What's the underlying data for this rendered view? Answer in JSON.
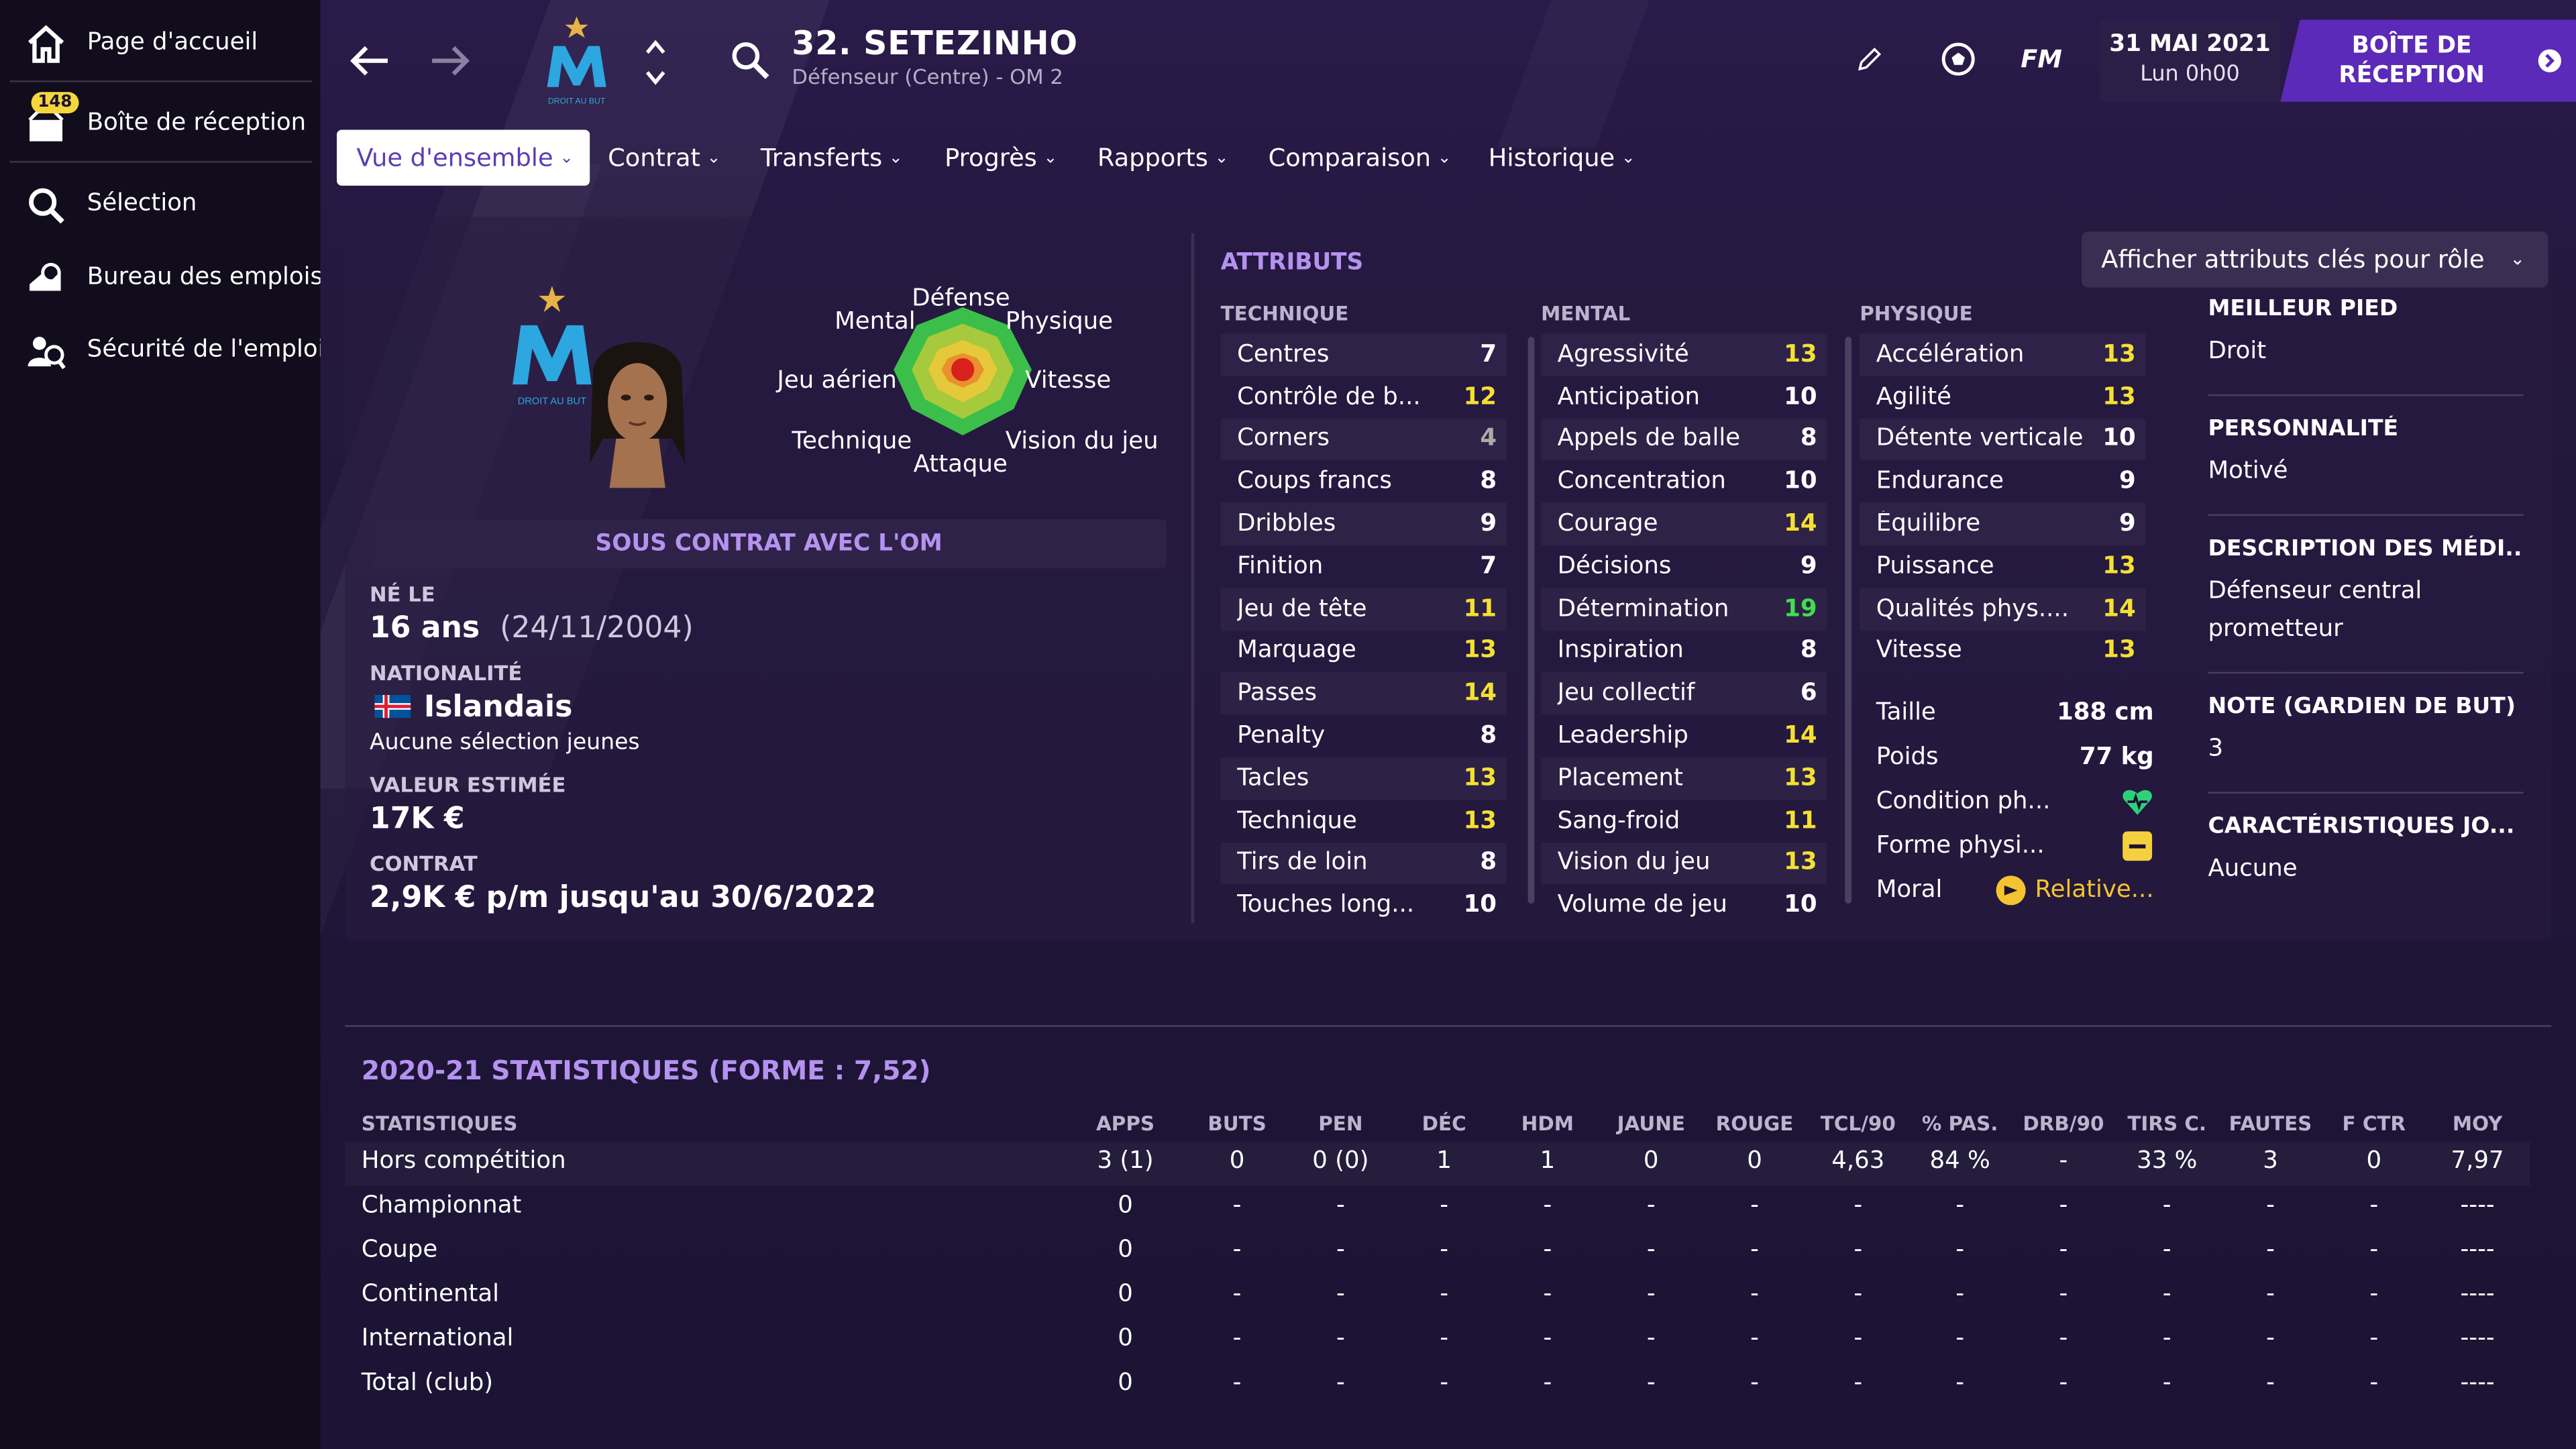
{
  "sidebar": {
    "items": [
      {
        "label": "Page d'accueil",
        "icon": "home-icon"
      },
      {
        "label": "Boîte de réception",
        "icon": "inbox-icon",
        "badge": "148"
      },
      {
        "label": "Sélection",
        "icon": "search-icon"
      },
      {
        "label": "Bureau des emplois",
        "icon": "job-centre-icon"
      },
      {
        "label": "Sécurité de l'emploi",
        "icon": "job-security-icon"
      }
    ]
  },
  "header": {
    "player_name": "32. SETEZINHO",
    "player_role": "Défenseur (Centre) - OM 2",
    "fm_label": "FM",
    "date": "31 MAI 2021",
    "time": "Lun 0h00",
    "inbox_button": "BOÎTE DE RÉCEPTION"
  },
  "tabs": [
    "Vue d'ensemble",
    "Contrat",
    "Transferts",
    "Progrès",
    "Rapports",
    "Comparaison",
    "Historique"
  ],
  "radar_labels": {
    "defense": "Défense",
    "mental": "Mental",
    "physique": "Physique",
    "jeu_aerien": "Jeu aérien",
    "vitesse": "Vitesse",
    "technique": "Technique",
    "vision": "Vision du jeu",
    "attaque": "Attaque"
  },
  "crest_text": "DROIT AU BUT",
  "profile": {
    "contract_banner": "SOUS CONTRAT AVEC L'OM",
    "born_label": "NÉ LE",
    "age": "16 ans",
    "dob": "(24/11/2004)",
    "nationality_label": "NATIONALITÉ",
    "nationality": "Islandais",
    "caps": "Aucune sélection jeunes",
    "value_label": "VALEUR ESTIMÉE",
    "value": "17K €",
    "contract_label": "CONTRAT",
    "contract": "2,9K € p/m jusqu'au 30/6/2022"
  },
  "attributes": {
    "title": "ATTRIBUTS",
    "role_button": "Afficher attributs clés pour rôle",
    "technique_header": "TECHNIQUE",
    "mental_header": "MENTAL",
    "physique_header": "PHYSIQUE",
    "technique": [
      {
        "name": "Centres",
        "value": "7"
      },
      {
        "name": "Contrôle de b...",
        "value": "12"
      },
      {
        "name": "Corners",
        "value": "4"
      },
      {
        "name": "Coups francs",
        "value": "8"
      },
      {
        "name": "Dribbles",
        "value": "9"
      },
      {
        "name": "Finition",
        "value": "7"
      },
      {
        "name": "Jeu de tête",
        "value": "11"
      },
      {
        "name": "Marquage",
        "value": "13"
      },
      {
        "name": "Passes",
        "value": "14"
      },
      {
        "name": "Penalty",
        "value": "8"
      },
      {
        "name": "Tacles",
        "value": "13"
      },
      {
        "name": "Technique",
        "value": "13"
      },
      {
        "name": "Tirs de loin",
        "value": "8"
      },
      {
        "name": "Touches long...",
        "value": "10"
      }
    ],
    "mental": [
      {
        "name": "Agressivité",
        "value": "13"
      },
      {
        "name": "Anticipation",
        "value": "10"
      },
      {
        "name": "Appels de balle",
        "value": "8"
      },
      {
        "name": "Concentration",
        "value": "10"
      },
      {
        "name": "Courage",
        "value": "14"
      },
      {
        "name": "Décisions",
        "value": "9"
      },
      {
        "name": "Détermination",
        "value": "19"
      },
      {
        "name": "Inspiration",
        "value": "8"
      },
      {
        "name": "Jeu collectif",
        "value": "6"
      },
      {
        "name": "Leadership",
        "value": "14"
      },
      {
        "name": "Placement",
        "value": "13"
      },
      {
        "name": "Sang-froid",
        "value": "11"
      },
      {
        "name": "Vision du jeu",
        "value": "13"
      },
      {
        "name": "Volume de jeu",
        "value": "10"
      }
    ],
    "physique": [
      {
        "name": "Accélération",
        "value": "13"
      },
      {
        "name": "Agilité",
        "value": "13"
      },
      {
        "name": "Détente verticale",
        "value": "10"
      },
      {
        "name": "Endurance",
        "value": "9"
      },
      {
        "name": "Équilibre",
        "value": "9"
      },
      {
        "name": "Puissance",
        "value": "13"
      },
      {
        "name": "Qualités phys....",
        "value": "14"
      },
      {
        "name": "Vitesse",
        "value": "13"
      }
    ],
    "physical_extra": {
      "height_label": "Taille",
      "height": "188 cm",
      "weight_label": "Poids",
      "weight": "77 kg",
      "condition_label": "Condition ph...",
      "form_label": "Forme physi...",
      "morale_label": "Moral",
      "morale": "Relative..."
    }
  },
  "colors": {
    "grey": "#aaaaaa",
    "white": "#ffffff",
    "yellow": "#f4e033",
    "green": "#3fe04f",
    "accent": "#b592f0"
  },
  "side_info": [
    {
      "label": "MEILLEUR PIED",
      "value": "Droit"
    },
    {
      "label": "PERSONNALITÉ",
      "value": "Motivé"
    },
    {
      "label": "DESCRIPTION DES MÉDI...",
      "value": "Défenseur central prometteur"
    },
    {
      "label": "NOTE (GARDIEN DE BUT)",
      "value": "3"
    },
    {
      "label": "CARACTÉRISTIQUES JO...",
      "value": "Aucune"
    }
  ],
  "stats": {
    "title": "2020-21 STATISTIQUES (FORME : 7,52)",
    "headers": [
      "STATISTIQUES",
      "APPS",
      "BUTS",
      "PEN",
      "DÉC",
      "HDM",
      "JAUNE",
      "ROUGE",
      "TCL/90",
      "% PAS.",
      "DRB/90",
      "TIRS C.",
      "FAUTES",
      "F CTR",
      "MOY"
    ],
    "rows": [
      [
        "Hors compétition",
        "3 (1)",
        "0",
        "0 (0)",
        "1",
        "1",
        "0",
        "0",
        "4,63",
        "84 %",
        "-",
        "33 %",
        "3",
        "0",
        "7,97"
      ],
      [
        "Championnat",
        "0",
        "-",
        "-",
        "-",
        "-",
        "-",
        "-",
        "-",
        "-",
        "-",
        "-",
        "-",
        "-",
        "----"
      ],
      [
        "Coupe",
        "0",
        "-",
        "-",
        "-",
        "-",
        "-",
        "-",
        "-",
        "-",
        "-",
        "-",
        "-",
        "-",
        "----"
      ],
      [
        "Continental",
        "0",
        "-",
        "-",
        "-",
        "-",
        "-",
        "-",
        "-",
        "-",
        "-",
        "-",
        "-",
        "-",
        "----"
      ],
      [
        "International",
        "0",
        "-",
        "-",
        "-",
        "-",
        "-",
        "-",
        "-",
        "-",
        "-",
        "-",
        "-",
        "-",
        "----"
      ],
      [
        "Total (club)",
        "0",
        "-",
        "-",
        "-",
        "-",
        "-",
        "-",
        "-",
        "-",
        "-",
        "-",
        "-",
        "-",
        "----"
      ]
    ]
  }
}
